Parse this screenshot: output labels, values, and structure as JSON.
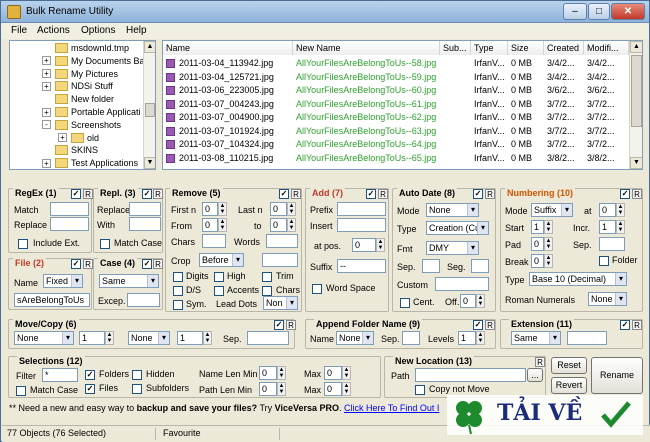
{
  "window": {
    "title": "Bulk Rename Utility"
  },
  "menu": [
    "File",
    "Actions",
    "Options",
    "Help"
  ],
  "tree": [
    {
      "label": "msdownld.tmp",
      "expander": ""
    },
    {
      "label": "My Documents Ba",
      "expander": "+"
    },
    {
      "label": "My Pictures",
      "expander": "+"
    },
    {
      "label": "NDSi Stuff",
      "expander": "+"
    },
    {
      "label": "New folder",
      "expander": ""
    },
    {
      "label": "Portable Applicati",
      "expander": "+"
    },
    {
      "label": "Screenshots",
      "expander": "-"
    },
    {
      "label": "old",
      "expander": "+"
    },
    {
      "label": "SKINS",
      "expander": ""
    },
    {
      "label": "Test Applications",
      "expander": "+"
    }
  ],
  "files": {
    "columns": [
      "Name",
      "New Name",
      "Sub...",
      "Type",
      "Size",
      "Created",
      "Modifi..."
    ],
    "rows": [
      [
        "2011-03-04_113942.jpg",
        "AllYourFilesAreBelongToUs--58.jpg",
        "",
        "IrfanV...",
        "0 MB",
        "3/4/2...",
        "3/4/2..."
      ],
      [
        "2011-03-04_125721.jpg",
        "AllYourFilesAreBelongToUs--59.jpg",
        "",
        "IrfanV...",
        "0 MB",
        "3/4/2...",
        "3/4/2..."
      ],
      [
        "2011-03-06_223005.jpg",
        "AllYourFilesAreBelongToUs--60.jpg",
        "",
        "IrfanV...",
        "0 MB",
        "3/6/2...",
        "3/6/2..."
      ],
      [
        "2011-03-07_004243.jpg",
        "AllYourFilesAreBelongToUs--61.jpg",
        "",
        "IrfanV...",
        "0 MB",
        "3/7/2...",
        "3/7/2..."
      ],
      [
        "2011-03-07_004900.jpg",
        "AllYourFilesAreBelongToUs--62.jpg",
        "",
        "IrfanV...",
        "0 MB",
        "3/7/2...",
        "3/7/2..."
      ],
      [
        "2011-03-07_101924.jpg",
        "AllYourFilesAreBelongToUs--63.jpg",
        "",
        "IrfanV...",
        "0 MB",
        "3/7/2...",
        "3/7/2..."
      ],
      [
        "2011-03-07_104324.jpg",
        "AllYourFilesAreBelongToUs--64.jpg",
        "",
        "IrfanV...",
        "0 MB",
        "3/7/2...",
        "3/7/2..."
      ],
      [
        "2011-03-08_110215.jpg",
        "AllYourFilesAreBelongToUs--65.jpg",
        "",
        "IrfanV...",
        "0 MB",
        "3/8/2...",
        "3/8/2..."
      ]
    ]
  },
  "regex": {
    "title": "RegEx (1)",
    "match": "Match",
    "replace": "Replace",
    "include_ext": "Include Ext."
  },
  "repl": {
    "title": "Repl. (3)",
    "replace": "Replace",
    "with": "With",
    "match_case": "Match Case"
  },
  "remove": {
    "title": "Remove (5)",
    "first_n": "First n",
    "first_n_val": "0",
    "last_n": "Last n",
    "last_n_val": "0",
    "from": "From",
    "from_val": "0",
    "to": "to",
    "to_val": "0",
    "chars": "Chars",
    "words": "Words",
    "crop": "Crop",
    "crop_val": "Before",
    "digits": "Digits",
    "high": "High",
    "trim": "Trim",
    "ds": "D/S",
    "accents": "Accents",
    "chars2": "Chars",
    "sym": "Sym.",
    "lead_dots": "Lead Dots",
    "lead_dots_val": "Non"
  },
  "add": {
    "title": "Add (7)",
    "prefix": "Prefix",
    "insert": "Insert",
    "at_pos": "at pos.",
    "at_pos_val": "0",
    "suffix": "Suffix",
    "suffix_val": "--",
    "word_space": "Word Space"
  },
  "autodate": {
    "title": "Auto Date (8)",
    "mode": "Mode",
    "mode_val": "None",
    "type": "Type",
    "type_val": "Creation (Cur",
    "fmt": "Fmt",
    "fmt_val": "DMY",
    "sep": "Sep.",
    "seg": "Seg.",
    "custom": "Custom",
    "cent": "Cent.",
    "off": "Off.",
    "off_val": "0"
  },
  "numbering": {
    "title": "Numbering (10)",
    "mode": "Mode",
    "mode_val": "Suffix",
    "at": "at",
    "at_val": "0",
    "start": "Start",
    "start_val": "1",
    "incr": "Incr.",
    "incr_val": "1",
    "pad": "Pad",
    "pad_val": "0",
    "sep": "Sep.",
    "break": "Break",
    "break_val": "0",
    "folder": "Folder",
    "type": "Type",
    "type_val": "Base 10 (Decimal)",
    "roman": "Roman Numerals",
    "roman_val": "None"
  },
  "file": {
    "title": "File (2)",
    "name": "Name",
    "name_val": "Fixed",
    "value": "sAreBelongToUs"
  },
  "case": {
    "title": "Case (4)",
    "case_val": "Same",
    "excep": "Excep."
  },
  "movecopy": {
    "title": "Move/Copy (6)",
    "dd1": "None",
    "n1": "1",
    "dd2": "None",
    "n2": "1",
    "sep": "Sep."
  },
  "appendfolder": {
    "title": "Append Folder Name (9)",
    "name": "Name",
    "name_val": "None",
    "sep": "Sep.",
    "levels": "Levels",
    "levels_val": "1"
  },
  "extension": {
    "title": "Extension (11)",
    "val": "Same"
  },
  "selections": {
    "title": "Selections (12)",
    "filter": "Filter",
    "filter_val": "*",
    "folders": "Folders",
    "hidden": "Hidden",
    "files": "Files",
    "subfolders": "Subfolders",
    "match_case": "Match Case",
    "name_len_min": "Name Len Min",
    "name_len_min_val": "0",
    "max1": "Max",
    "max1_val": "0",
    "path_len_min": "Path Len Min",
    "path_len_min_val": "0",
    "max2": "Max",
    "max2_val": "0"
  },
  "newlocation": {
    "title": "New Location (13)",
    "path": "Path",
    "browse": "...",
    "copy_not_move": "Copy not Move"
  },
  "buttons": {
    "reset": "Reset",
    "revert": "Revert",
    "rename": "Rename"
  },
  "footer": {
    "pre": "** Need a new and easy way to ",
    "bold": "backup and save your files?",
    "mid": " Try ",
    "vv": "ViceVersa PRO",
    "dot": ". ",
    "link": "Click Here To Find Out I"
  },
  "status": {
    "objects": "77 Objects (76 Selected)",
    "favourite": "Favourite"
  },
  "watermark": "TẢI VỀ"
}
